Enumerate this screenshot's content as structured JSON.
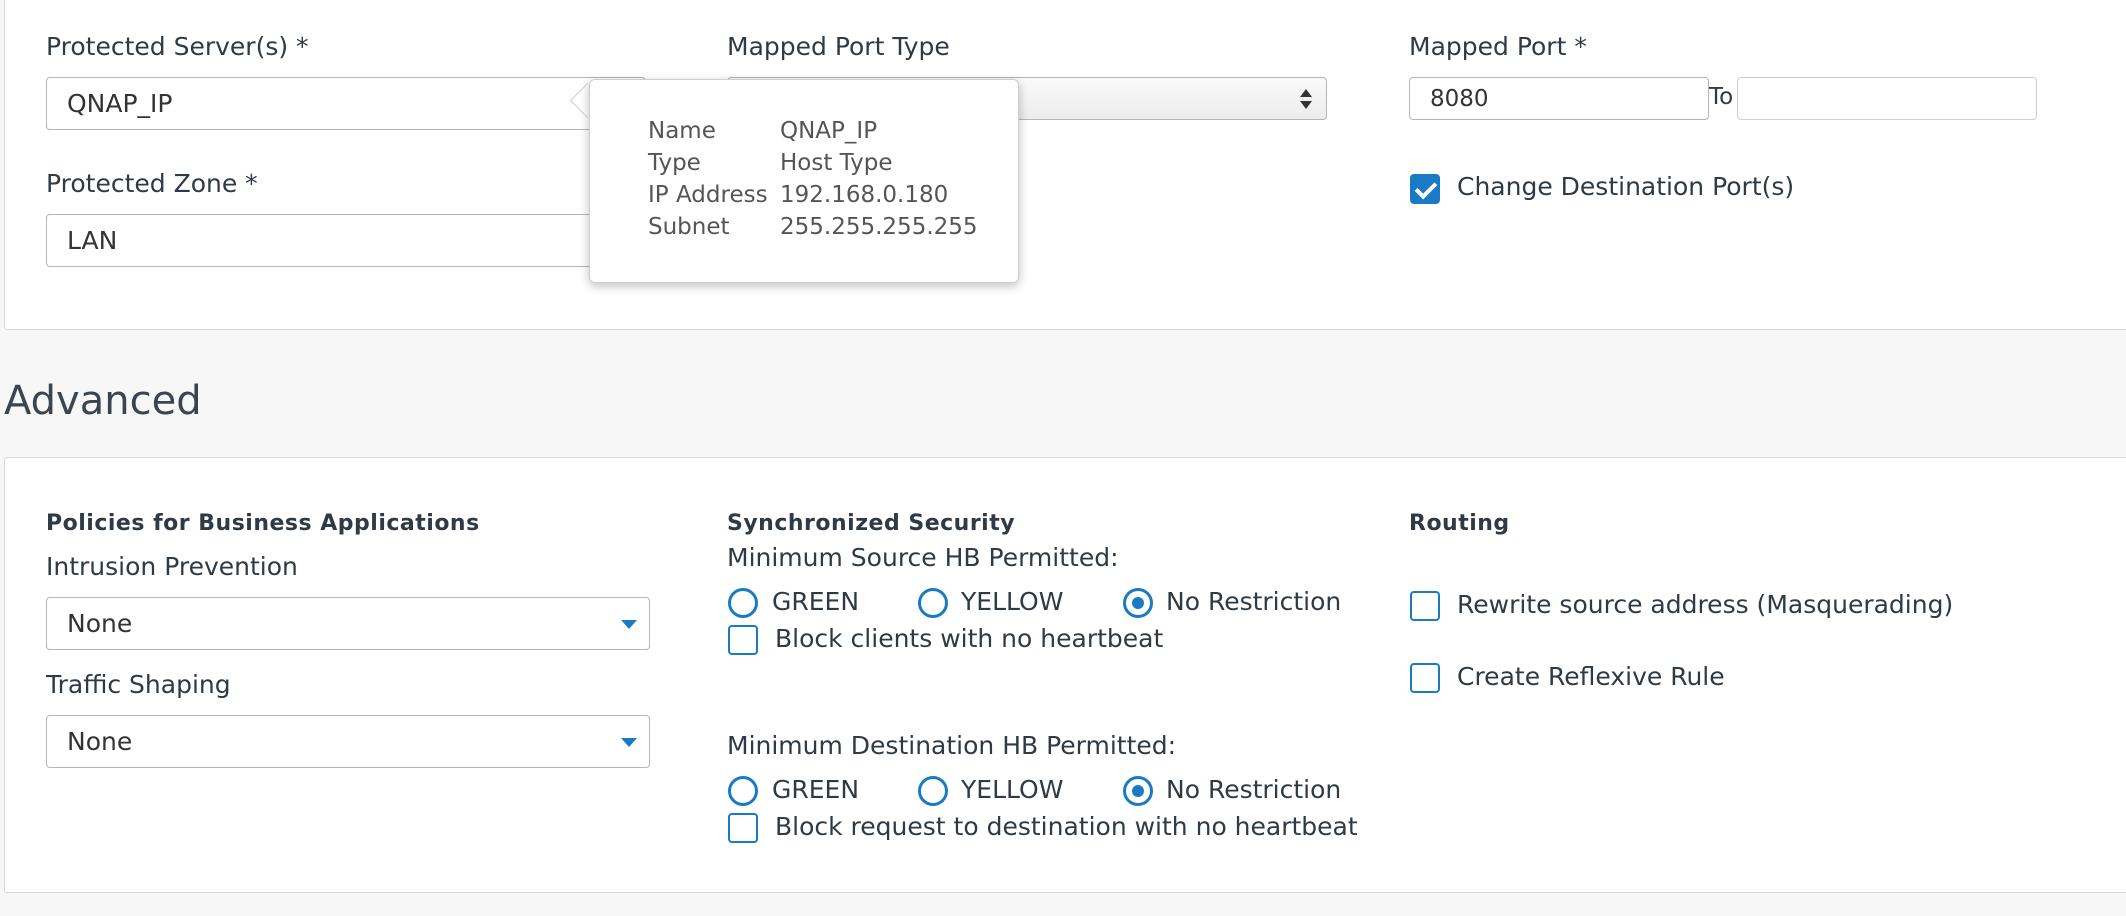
{
  "top_section": {
    "protected_servers_label": "Protected Server(s) *",
    "protected_servers_value": "QNAP_IP",
    "mapped_port_type_label": "Mapped Port Type",
    "mapped_port_type_value": "",
    "mapped_port_label": "Mapped Port *",
    "mapped_port_value": "8080",
    "to_label": "To",
    "to_value": "",
    "protected_zone_label": "Protected Zone *",
    "protected_zone_value": "LAN",
    "change_destination_label": "Change Destination Port(s)",
    "change_destination_checked": true
  },
  "tooltip": {
    "rows": [
      {
        "key": "Name",
        "value": "QNAP_IP"
      },
      {
        "key": "Type",
        "value": "Host Type"
      },
      {
        "key": "IP Address",
        "value": "192.168.0.180"
      },
      {
        "key": "Subnet",
        "value": "255.255.255.255"
      }
    ]
  },
  "advanced": {
    "title": "Advanced",
    "policies": {
      "heading": "Policies for Business Applications",
      "intrusion_label": "Intrusion Prevention",
      "intrusion_value": "None",
      "traffic_label": "Traffic Shaping",
      "traffic_value": "None"
    },
    "sync_security": {
      "heading": "Synchronized Security",
      "min_source_label": "Minimum Source HB Permitted:",
      "min_dest_label": "Minimum Destination HB Permitted:",
      "options": [
        "GREEN",
        "YELLOW",
        "No Restriction"
      ],
      "source_selected": "No Restriction",
      "dest_selected": "No Restriction",
      "block_clients_label": "Block clients with no heartbeat",
      "block_request_label": "Block request to destination with no heartbeat"
    },
    "routing": {
      "heading": "Routing",
      "rewrite_label": "Rewrite source address (Masquerading)",
      "reflexive_label": "Create Reflexive Rule"
    }
  },
  "colors": {
    "accent": "#1a7bc4",
    "background": "#f7f7f7",
    "panel": "#ffffff"
  }
}
